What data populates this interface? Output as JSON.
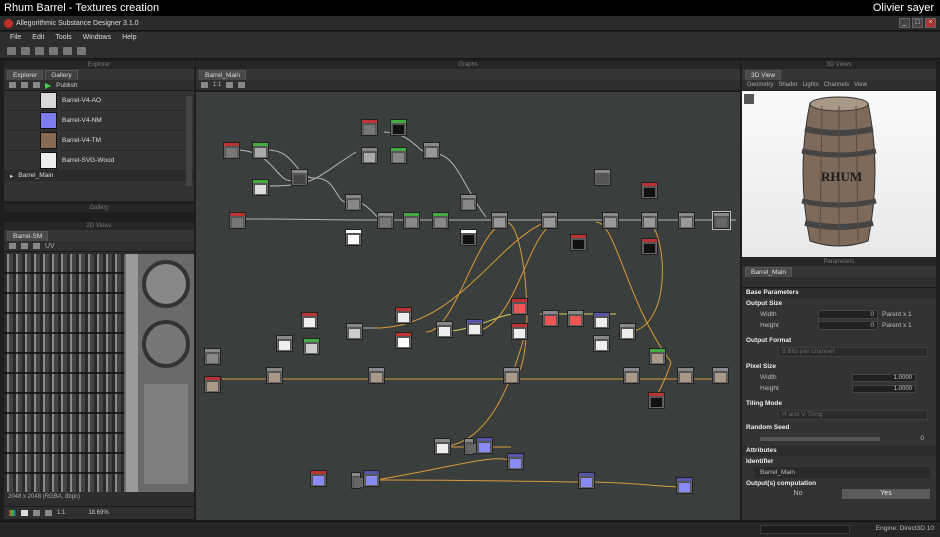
{
  "video": {
    "title": "Rhum Barrel - Textures creation",
    "author": "Olivier sayer"
  },
  "window": {
    "title": "Allegorithmic Substance Designer 3.1.0"
  },
  "menu": [
    "File",
    "Edit",
    "Tools",
    "Windows",
    "Help"
  ],
  "explorer": {
    "header": "Explorer",
    "tabs": [
      "Explorer",
      "Gallery"
    ],
    "publish_label": "Publish",
    "items": [
      {
        "label": "Barrel-V4-AO",
        "thumb": "#d8d8d8"
      },
      {
        "label": "Barrel-V4-NM",
        "thumb": "#7d7df0"
      },
      {
        "label": "Barrel-V4-TM",
        "thumb": "#8a6a50"
      },
      {
        "label": "Barrel-SVG-Wood",
        "thumb": "#eeeeee"
      }
    ],
    "graph_item": "Barrel_Main"
  },
  "gallery_header": "Gallery",
  "view2d": {
    "header": "2D Views",
    "tab": "Barrel-SM",
    "uv_label": "UV",
    "info": "2048 x 2048 (RGBA, 8bpc)",
    "ratio": "1:1",
    "zoom": "18.69%"
  },
  "graph": {
    "header": "Graphs",
    "tab": "Barrel_Main",
    "ratio": "1:1"
  },
  "view3d": {
    "header": "3D Views",
    "tab": "3D View",
    "menu": [
      "Geometry",
      "Shader",
      "Lights",
      "Channels",
      "View"
    ],
    "barrel_label": "RHUM"
  },
  "params": {
    "header": "Parameters",
    "tab": "Barrel_Main",
    "base_section": "Base Parameters",
    "output_size": {
      "label": "Output Size",
      "width_label": "Width",
      "width_value": "0",
      "width_mode": "Parent x 1",
      "height_label": "Height",
      "height_value": "0",
      "height_mode": "Parent x 1"
    },
    "output_format": {
      "label": "Output Format",
      "value": "8 Bits per channel"
    },
    "pixel_size": {
      "label": "Pixel Size",
      "width_label": "Width",
      "width_value": "1.0000",
      "height_label": "Height",
      "height_value": "1.0000"
    },
    "tiling": {
      "label": "Tiling Mode",
      "value": "H and V Tiling"
    },
    "seed": {
      "label": "Random Seed",
      "value": "0"
    },
    "attributes_section": "Attributes",
    "identifier_label": "Identifier",
    "identifier_value": "Barrel_Main",
    "outputs_label": "Output(s) computation",
    "no_label": "No",
    "yes_label": "Yes"
  },
  "status": {
    "engine": "Engine: Direct3D 10"
  }
}
